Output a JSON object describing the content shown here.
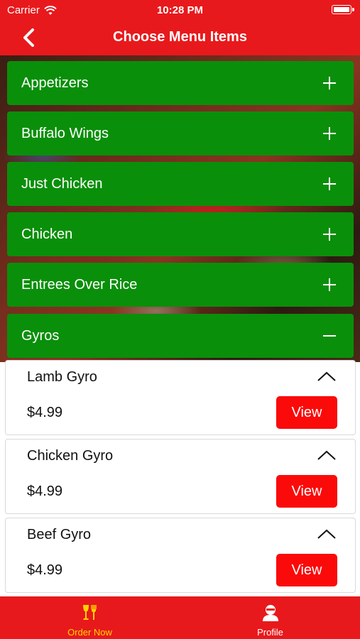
{
  "status_bar": {
    "carrier": "Carrier",
    "time": "10:28 PM"
  },
  "nav": {
    "title": "Choose Menu Items",
    "back_icon": "chevron-left-icon"
  },
  "categories": [
    {
      "label": "Appetizers",
      "state": "collapsed"
    },
    {
      "label": "Buffalo Wings",
      "state": "collapsed"
    },
    {
      "label": "Just Chicken",
      "state": "collapsed"
    },
    {
      "label": "Chicken",
      "state": "collapsed"
    },
    {
      "label": "Entrees Over Rice",
      "state": "collapsed"
    },
    {
      "label": "Gyros",
      "state": "expanded"
    }
  ],
  "items": [
    {
      "name": "Lamb Gyro",
      "price": "$4.99",
      "button": "View"
    },
    {
      "name": "Chicken Gyro",
      "price": "$4.99",
      "button": "View"
    },
    {
      "name": "Beef Gyro",
      "price": "$4.99",
      "button": "View"
    }
  ],
  "tab_bar": {
    "tabs": [
      {
        "label": "Order Now",
        "icon": "dining-icon",
        "active": true
      },
      {
        "label": "Profile",
        "icon": "profile-icon",
        "active": false
      }
    ]
  },
  "colors": {
    "primary_red": "#e8191c",
    "category_green": "#0a8f0a",
    "view_button_red": "#fb0a0a",
    "active_tab": "#ffd400",
    "inactive_tab": "#ffffff"
  }
}
